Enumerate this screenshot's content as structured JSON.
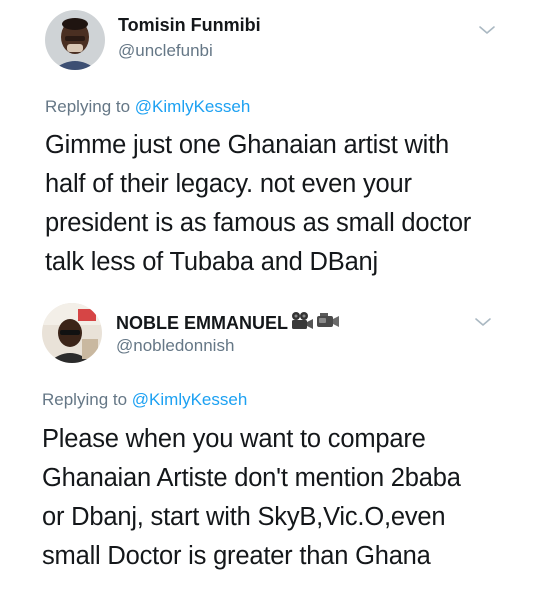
{
  "tweets": [
    {
      "name": "Tomisin Funmibi",
      "handle": "@unclefunbi",
      "reply_prefix": "Replying to ",
      "reply_to": "@KimlyKesseh",
      "text_lines": [
        "Gimme just one Ghanaian artist with",
        "half of their legacy. not even your",
        "president is as famous as small doctor",
        "talk less of Tubaba and DBanj"
      ],
      "menu_icon": "chevron-down-icon"
    },
    {
      "name": "NOBLE EMMANUEL",
      "name_emojis": [
        "movie-camera-icon",
        "video-camera-icon"
      ],
      "handle": "@nobledonnish",
      "reply_prefix": "Replying to ",
      "reply_to": "@KimlyKesseh",
      "text_lines": [
        "Please when you want to compare",
        "Ghanaian Artiste don't mention 2baba",
        "or Dbanj, start with SkyB,Vic.O,even",
        "small Doctor is greater than Ghana"
      ],
      "menu_icon": "chevron-down-icon"
    }
  ],
  "colors": {
    "text": "#14171a",
    "secondary": "#657786",
    "link": "#1da1f2"
  }
}
